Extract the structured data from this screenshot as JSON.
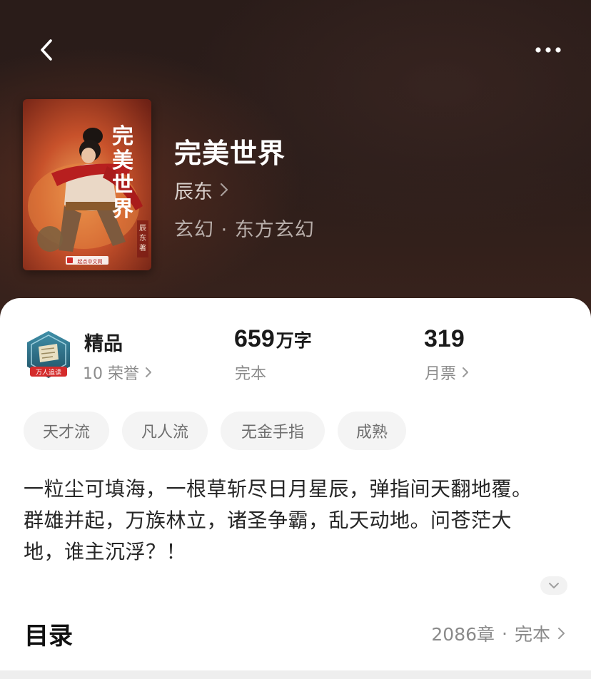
{
  "book": {
    "title": "完美世界",
    "author": "辰东",
    "genre": "玄幻 · 东方玄幻",
    "cover": {
      "title_text": "完美世界",
      "author_text": "辰东著",
      "publisher_text": "起点中文网"
    }
  },
  "stats": {
    "quality": {
      "label": "精品",
      "honors": "10 荣誉"
    },
    "badge": {
      "text": "万人追读"
    },
    "words": {
      "number": "659",
      "unit": "万字",
      "status": "完本"
    },
    "tickets": {
      "number": "319",
      "label": "月票"
    }
  },
  "tags": [
    "天才流",
    "凡人流",
    "无金手指",
    "成熟"
  ],
  "synopsis": {
    "line1": "一粒尘可填海，一根草斩尽日月星辰，弹指间天翻地覆。",
    "line2": "群雄并起，万族林立，诸圣争霸，乱天动地。问苍茫大地，谁主沉浮？！"
  },
  "toc": {
    "title": "目录",
    "chapters": "2086章",
    "status": "完本"
  },
  "colors": {
    "hero_bg": "#2b1d1a",
    "sheet_bg": "#ffffff",
    "chip_bg": "#f4f4f4",
    "muted_text": "#8c8c8c"
  }
}
